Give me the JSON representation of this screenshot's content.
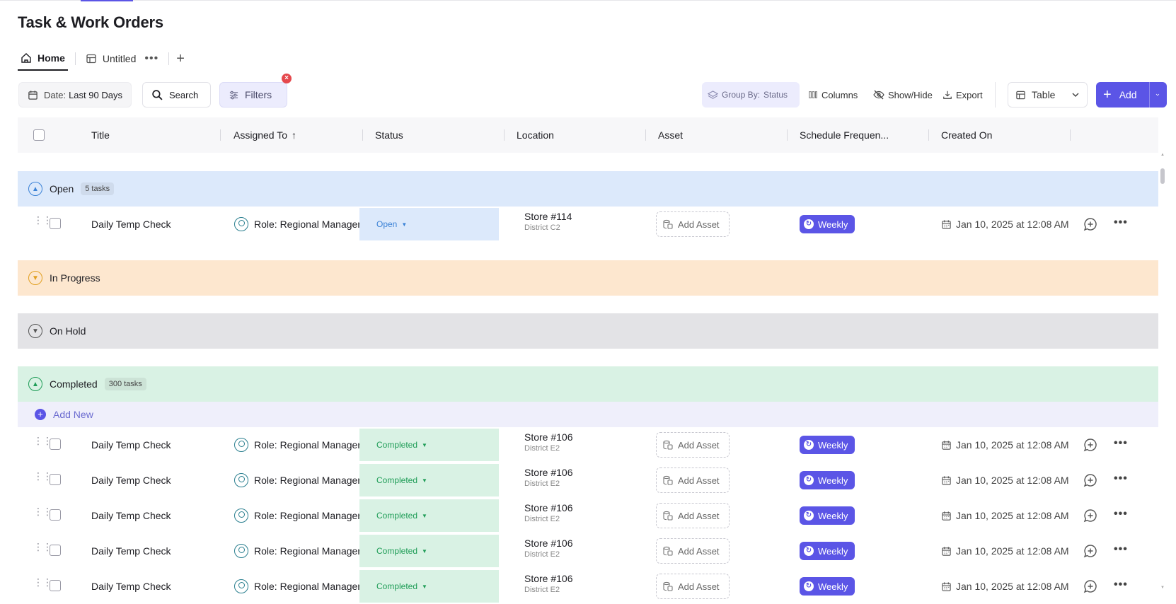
{
  "page": {
    "title": "Task & Work Orders"
  },
  "tabs": [
    {
      "label": "Home",
      "icon": "home-icon"
    },
    {
      "label": "Untitled",
      "icon": "table-icon"
    }
  ],
  "toolbar": {
    "date_label": "Date:",
    "date_value": "Last 90 Days",
    "search_label": "Search",
    "filters_label": "Filters",
    "group_by_label": "Group By:",
    "group_by_value": "Status",
    "columns_label": "Columns",
    "show_hide_label": "Show/Hide",
    "export_label": "Export",
    "view_label": "Table",
    "add_label": "Add"
  },
  "columns": [
    "Title",
    "Assigned To",
    "Status",
    "Location",
    "Asset",
    "Schedule Frequen...",
    "Created On"
  ],
  "groups": {
    "open": {
      "label": "Open",
      "count": "5 tasks"
    },
    "in_progress": {
      "label": "In Progress"
    },
    "on_hold": {
      "label": "On Hold"
    },
    "completed": {
      "label": "Completed",
      "count": "300 tasks"
    }
  },
  "add_new_label": "Add New",
  "rows": [
    {
      "title": "Daily Temp Check",
      "assigned": "Role: Regional Manager",
      "status": "Open",
      "store": "Store #114",
      "district": "District C2",
      "asset": "Add Asset",
      "schedule": "Weekly",
      "created": "Jan 10, 2025 at 12:08 AM"
    },
    {
      "title": "Daily Temp Check",
      "assigned": "Role: Regional Manager",
      "status": "Completed",
      "store": "Store #106",
      "district": "District E2",
      "asset": "Add Asset",
      "schedule": "Weekly",
      "created": "Jan 10, 2025 at 12:08 AM"
    },
    {
      "title": "Daily Temp Check",
      "assigned": "Role: Regional Manager",
      "status": "Completed",
      "store": "Store #106",
      "district": "District E2",
      "asset": "Add Asset",
      "schedule": "Weekly",
      "created": "Jan 10, 2025 at 12:08 AM"
    },
    {
      "title": "Daily Temp Check",
      "assigned": "Role: Regional Manager",
      "status": "Completed",
      "store": "Store #106",
      "district": "District E2",
      "asset": "Add Asset",
      "schedule": "Weekly",
      "created": "Jan 10, 2025 at 12:08 AM"
    },
    {
      "title": "Daily Temp Check",
      "assigned": "Role: Regional Manager",
      "status": "Completed",
      "store": "Store #106",
      "district": "District E2",
      "asset": "Add Asset",
      "schedule": "Weekly",
      "created": "Jan 10, 2025 at 12:08 AM"
    },
    {
      "title": "Daily Temp Check",
      "assigned": "Role: Regional Manager",
      "status": "Completed",
      "store": "Store #106",
      "district": "District E2",
      "asset": "Add Asset",
      "schedule": "Weekly",
      "created": "Jan 10, 2025 at 12:08 AM"
    }
  ],
  "colors": {
    "accent": "#5b55e6",
    "open": "#dce9fb",
    "in_progress": "#fde7cf",
    "on_hold": "#e3e3e6",
    "completed": "#d9f2e4"
  }
}
